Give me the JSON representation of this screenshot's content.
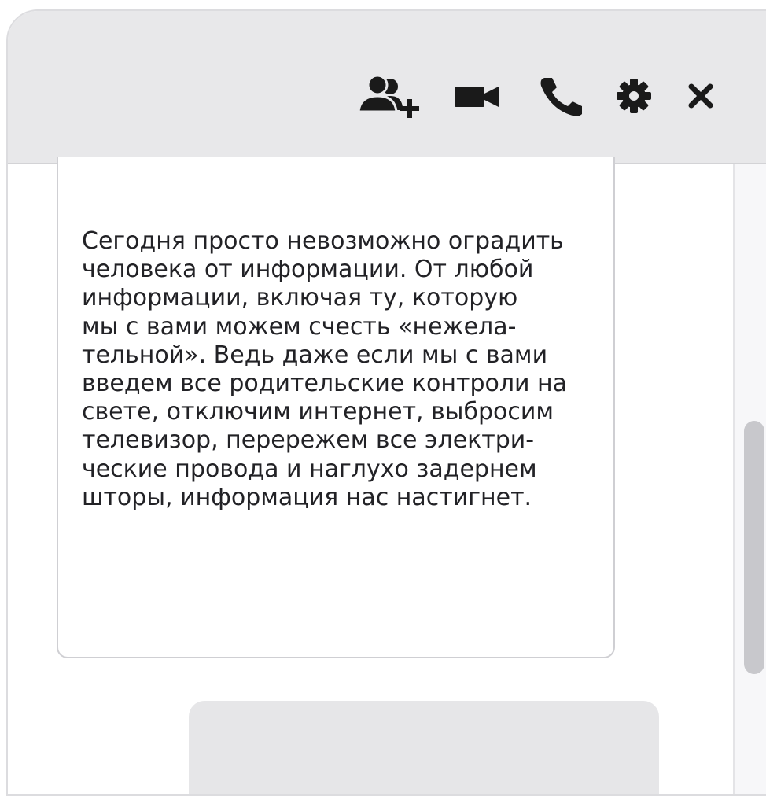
{
  "header": {
    "icons": {
      "add_user": "add-user-icon",
      "video": "video-camera-icon",
      "phone": "phone-icon",
      "settings": "gear-icon",
      "close": "close-icon"
    },
    "background_color": "#e8e8ea",
    "icon_color": "#1a1a1a"
  },
  "message": {
    "text": "Сегодня просто невозможно оградить\nчеловека от информации. От любой\nинформации, включая ту, которую\nмы с вами можем счесть «нежела-\nтельной». Ведь даже если мы с вами\nвведем все родительские контроли на\nсвете, отключим интернет, выбросим\nтелевизор, перережем все электри-\nческие провода и наглухо задернем\nшторы, информация нас настигнет."
  },
  "scrollbar": {
    "thumb_color": "#c8c8cc"
  }
}
